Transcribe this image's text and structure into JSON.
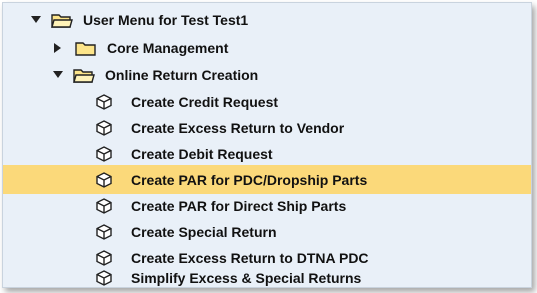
{
  "tree": {
    "root": {
      "label": "User Menu for Test Test1",
      "expanded": true,
      "icon": "folder-open-icon"
    },
    "folders": [
      {
        "label": "Core Management",
        "expanded": false,
        "icon": "folder-closed-icon"
      },
      {
        "label": "Online Return Creation",
        "expanded": true,
        "icon": "folder-open-icon"
      }
    ],
    "items": [
      {
        "label": "Create Credit Request",
        "icon": "transaction-cube-icon",
        "selected": false
      },
      {
        "label": "Create Excess Return to Vendor",
        "icon": "transaction-cube-icon",
        "selected": false
      },
      {
        "label": "Create Debit Request",
        "icon": "transaction-cube-icon",
        "selected": false
      },
      {
        "label": "Create PAR for PDC/Dropship Parts",
        "icon": "transaction-cube-icon",
        "selected": true
      },
      {
        "label": "Create PAR for Direct Ship Parts",
        "icon": "transaction-cube-icon",
        "selected": false
      },
      {
        "label": "Create Special Return",
        "icon": "transaction-cube-icon",
        "selected": false
      },
      {
        "label": "Create Excess Return to DTNA PDC",
        "icon": "transaction-cube-icon",
        "selected": false
      },
      {
        "label": "Simplify Excess & Special Returns",
        "icon": "transaction-cube-icon",
        "selected": false
      }
    ]
  },
  "colors": {
    "background": "#e9f0f8",
    "selected_row": "#fbd97a",
    "folder_fill": "#fde58a",
    "text": "#111111"
  }
}
